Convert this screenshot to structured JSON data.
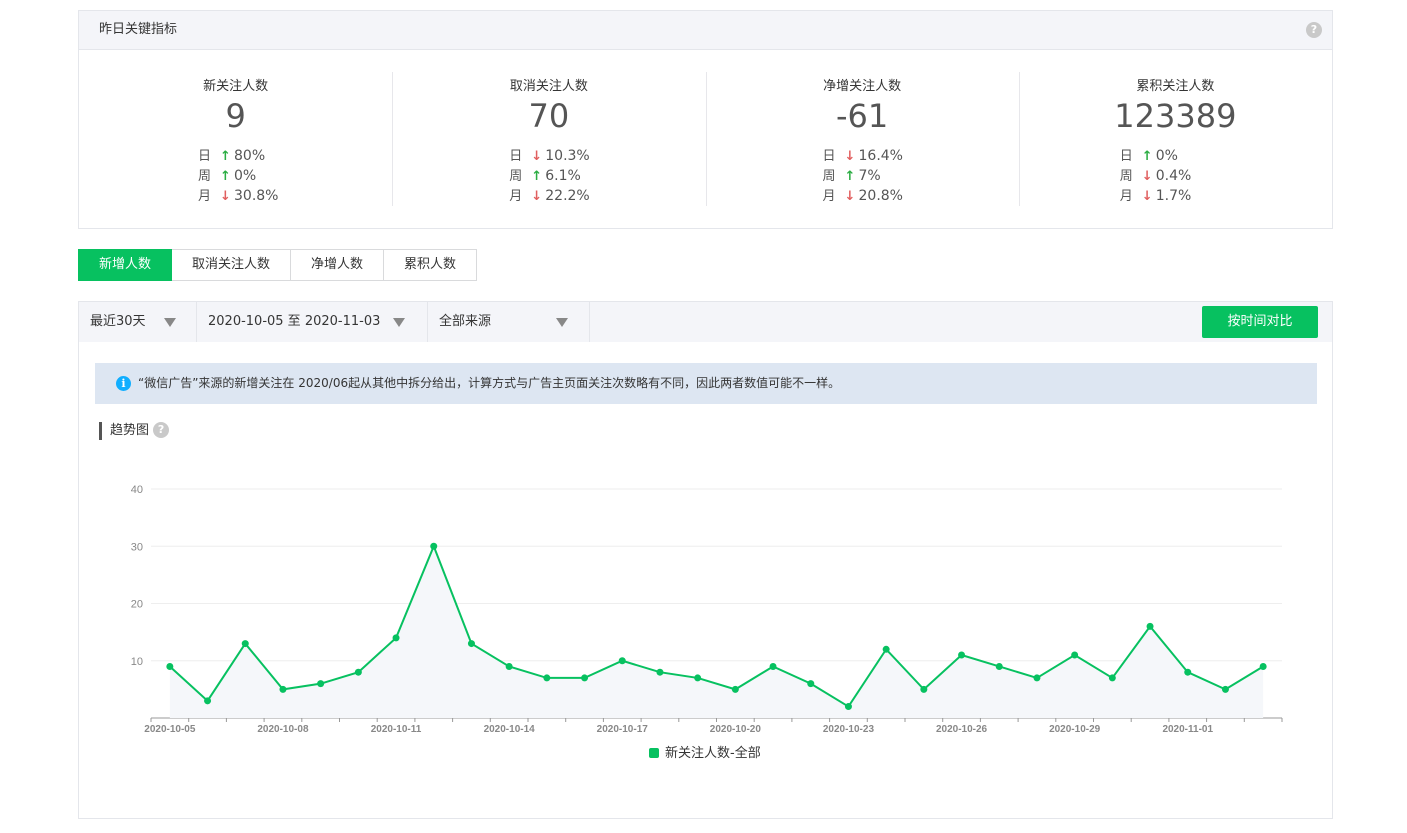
{
  "kpi": {
    "header": "昨日关键指标",
    "cards": [
      {
        "title": "新关注人数",
        "value": "9",
        "rows": [
          {
            "label": "日",
            "dir": "up",
            "pct": "80%"
          },
          {
            "label": "周",
            "dir": "up",
            "pct": "0%"
          },
          {
            "label": "月",
            "dir": "down",
            "pct": "30.8%"
          }
        ]
      },
      {
        "title": "取消关注人数",
        "value": "70",
        "rows": [
          {
            "label": "日",
            "dir": "down",
            "pct": "10.3%"
          },
          {
            "label": "周",
            "dir": "up",
            "pct": "6.1%"
          },
          {
            "label": "月",
            "dir": "down",
            "pct": "22.2%"
          }
        ]
      },
      {
        "title": "净增关注人数",
        "value": "-61",
        "rows": [
          {
            "label": "日",
            "dir": "down",
            "pct": "16.4%"
          },
          {
            "label": "周",
            "dir": "up",
            "pct": "7%"
          },
          {
            "label": "月",
            "dir": "down",
            "pct": "20.8%"
          }
        ]
      },
      {
        "title": "累积关注人数",
        "value": "123389",
        "rows": [
          {
            "label": "日",
            "dir": "up",
            "pct": "0%"
          },
          {
            "label": "周",
            "dir": "down",
            "pct": "0.4%"
          },
          {
            "label": "月",
            "dir": "down",
            "pct": "1.7%"
          }
        ]
      }
    ]
  },
  "tabs": [
    "新增人数",
    "取消关注人数",
    "净增人数",
    "累积人数"
  ],
  "filters": {
    "period": "最近30天",
    "date_range": "2020-10-05 至 2020-11-03",
    "source": "全部来源",
    "compare_button": "按时间对比"
  },
  "notice": "“微信广告”来源的新增关注在 2020/06起从其他中拆分给出，计算方式与广告主页面关注次数略有不同，因此两者数值可能不一样。",
  "trend_title": "趋势图",
  "colors": {
    "accent": "#07c160",
    "up": "#2bad43",
    "down": "#e15f5f",
    "info": "#10aeff"
  },
  "chart_data": {
    "type": "line",
    "x": [
      "2020-10-05",
      "2020-10-06",
      "2020-10-07",
      "2020-10-08",
      "2020-10-09",
      "2020-10-10",
      "2020-10-11",
      "2020-10-12",
      "2020-10-13",
      "2020-10-14",
      "2020-10-15",
      "2020-10-16",
      "2020-10-17",
      "2020-10-18",
      "2020-10-19",
      "2020-10-20",
      "2020-10-21",
      "2020-10-22",
      "2020-10-23",
      "2020-10-24",
      "2020-10-25",
      "2020-10-26",
      "2020-10-27",
      "2020-10-28",
      "2020-10-29",
      "2020-10-30",
      "2020-10-31",
      "2020-11-01",
      "2020-11-02",
      "2020-11-03"
    ],
    "x_tick_labels": [
      "2020-10-05",
      "2020-10-08",
      "2020-10-11",
      "2020-10-14",
      "2020-10-17",
      "2020-10-20",
      "2020-10-23",
      "2020-10-26",
      "2020-10-29",
      "2020-11-01"
    ],
    "series": [
      {
        "name": "新关注人数-全部",
        "color": "#07c160",
        "values": [
          9,
          3,
          13,
          5,
          6,
          8,
          14,
          30,
          13,
          9,
          7,
          7,
          10,
          8,
          7,
          5,
          9,
          6,
          2,
          12,
          5,
          11,
          9,
          7,
          11,
          7,
          16,
          8,
          5,
          9
        ]
      }
    ],
    "ylim": [
      0,
      40
    ],
    "yticks": [
      10,
      20,
      30,
      40
    ],
    "grid": true,
    "legend": "bottom"
  }
}
